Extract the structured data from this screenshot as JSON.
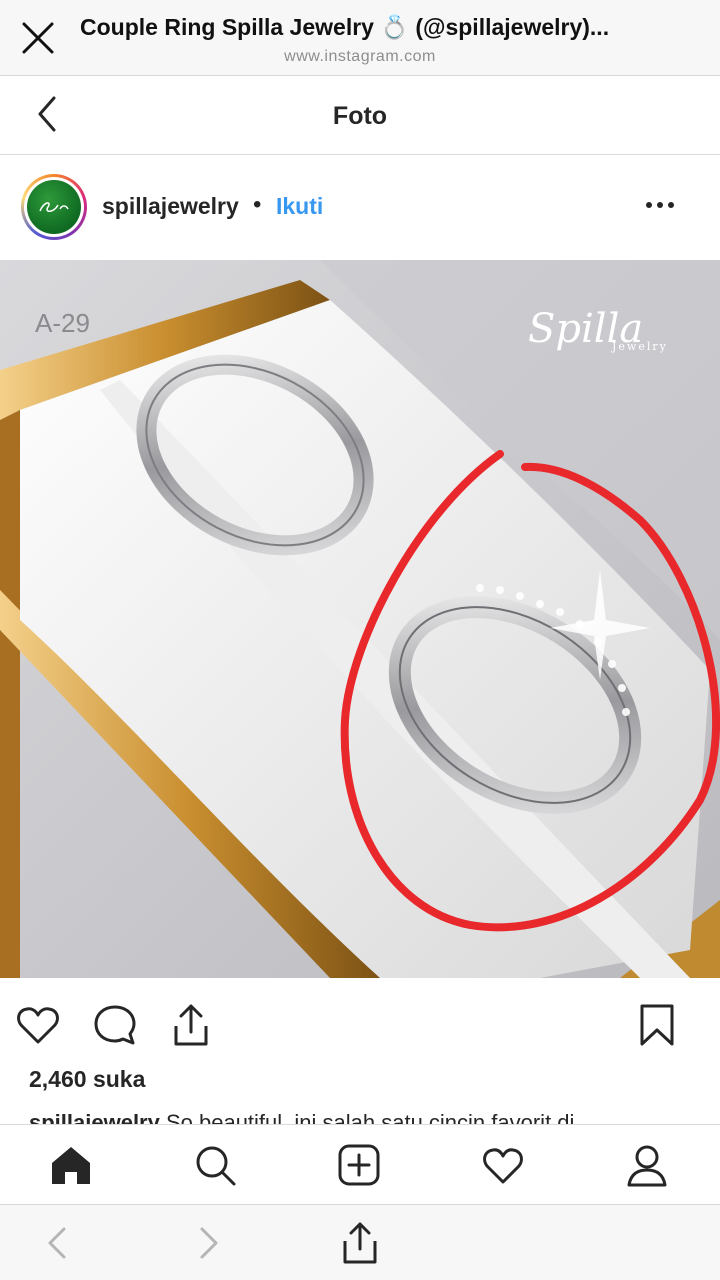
{
  "browser": {
    "title": "Couple Ring Spilla Jewelry 💍 (@spillajewelry)...",
    "url": "www.instagram.com"
  },
  "header": {
    "title": "Foto"
  },
  "post": {
    "username": "spillajewelry",
    "separator": "•",
    "follow_label": "Ikuti",
    "photo": {
      "code_label": "A-29",
      "watermark": "Spilla",
      "watermark_sub": "Jewelry"
    },
    "likes": "2,460 suka",
    "caption_user": "spillajewelry",
    "caption_text": " So beautiful, ini salah satu cincin favorit di"
  },
  "icons": {
    "close": "close-icon",
    "back": "chevron-left-icon",
    "more": "more-horizontal-icon",
    "like": "heart-icon",
    "comment": "comment-icon",
    "share": "share-icon",
    "save": "bookmark-icon",
    "home": "home-icon",
    "search": "search-icon",
    "add": "add-post-icon",
    "activity": "heart-icon",
    "profile": "profile-icon"
  },
  "colors": {
    "link_blue": "#3897f0",
    "annotation_red": "#e8282b",
    "avatar_green": "#1a7a2c"
  }
}
